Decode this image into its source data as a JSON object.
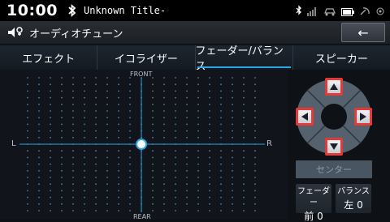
{
  "status": {
    "time": "10:00",
    "track_title": "Unknown Title-"
  },
  "header": {
    "title": "オーディオチューン",
    "back_label": "←"
  },
  "tabs": [
    {
      "label": "エフェクト",
      "active": false
    },
    {
      "label": "イコライザー",
      "active": false
    },
    {
      "label": "フェーダー/バランス",
      "active": true
    },
    {
      "label": "スピーカー",
      "active": false
    }
  ],
  "grid": {
    "front_label": "FRONT",
    "rear_label": "REAR",
    "left_label": "L",
    "right_label": "R"
  },
  "controls": {
    "center_label": "センター",
    "fader": {
      "label": "フェーダー",
      "value": "前 0"
    },
    "balance": {
      "label": "バランス",
      "value": "左 0"
    }
  },
  "colors": {
    "accent": "#2da4e6",
    "highlight": "#e53935"
  }
}
